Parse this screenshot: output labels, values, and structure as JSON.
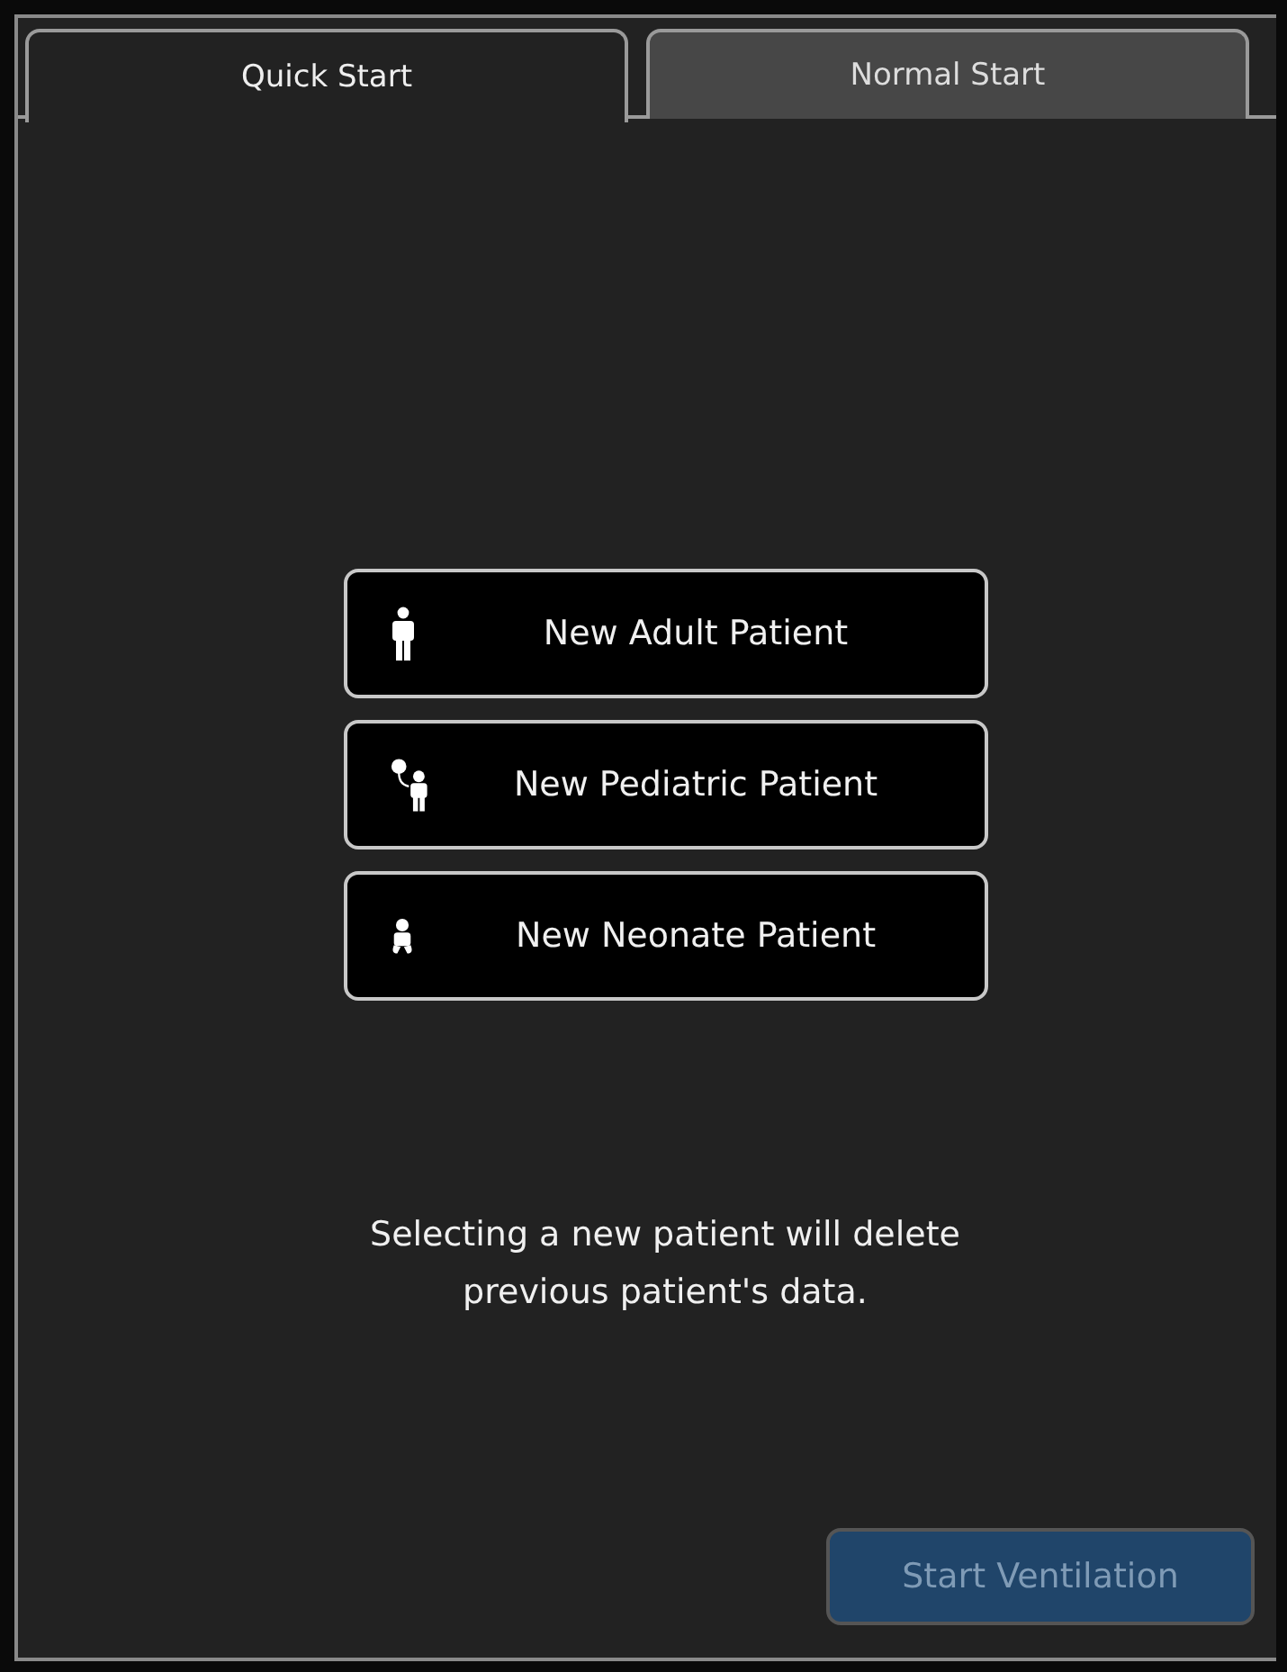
{
  "tabs": [
    {
      "label": "Quick Start",
      "selected": true
    },
    {
      "label": "Normal Start",
      "selected": false
    }
  ],
  "patient_buttons": [
    {
      "label": "New Adult Patient",
      "kind": "adult"
    },
    {
      "label": "New Pediatric Patient",
      "kind": "pediatric"
    },
    {
      "label": "New Neonate Patient",
      "kind": "neonate"
    }
  ],
  "message": "Selecting a new patient will delete previous patient's data.",
  "start_button": {
    "label": "Start Ventilation",
    "disabled": true
  }
}
